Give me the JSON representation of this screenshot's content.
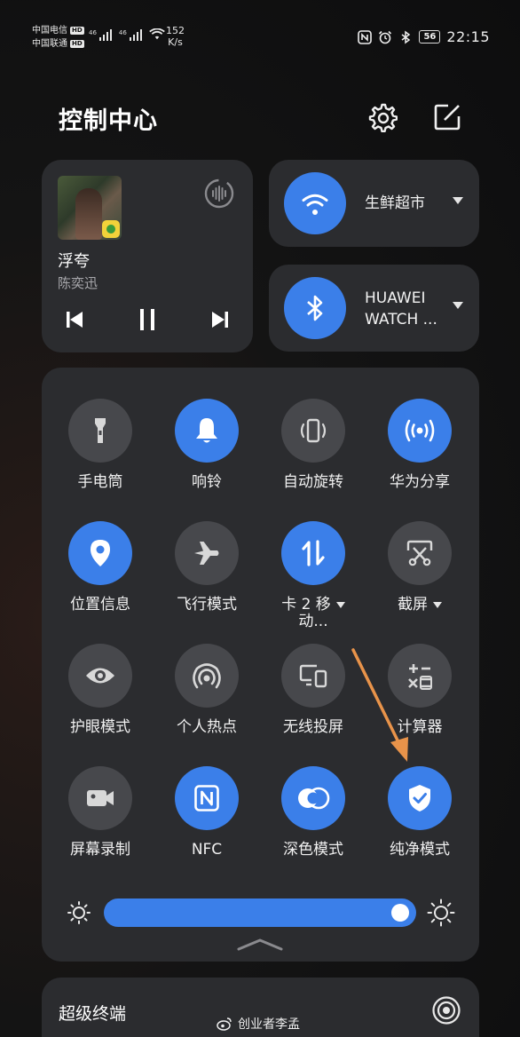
{
  "status_bar": {
    "carrier_1": "中国电信",
    "carrier_2": "中国联通",
    "hd_badge": "HD",
    "sig_1": "46",
    "sig_2": "46",
    "net_speed_value": "152",
    "net_speed_unit": "K/s",
    "battery": "56",
    "time": "22:15",
    "icons": [
      "nfc-icon",
      "alarm-icon",
      "bluetooth-icon"
    ]
  },
  "header": {
    "title": "控制中心",
    "settings_icon": "gear-icon",
    "edit_icon": "edit-icon"
  },
  "media": {
    "song": "浮夸",
    "artist": "陈奕迅",
    "controls": [
      "previous-icon",
      "pause-icon",
      "next-icon"
    ]
  },
  "wifi": {
    "label": "生鲜超市",
    "icon": "wifi-icon"
  },
  "bluetooth": {
    "label_line1": "HUAWEI",
    "label_line2": "WATCH ...",
    "icon": "bluetooth-icon"
  },
  "tiles": [
    {
      "label": "手电筒",
      "icon": "flashlight-icon",
      "on": false
    },
    {
      "label": "响铃",
      "icon": "bell-icon",
      "on": true
    },
    {
      "label": "自动旋转",
      "icon": "rotate-icon",
      "on": false
    },
    {
      "label": "华为分享",
      "icon": "share-icon",
      "on": true
    },
    {
      "label": "位置信息",
      "icon": "location-icon",
      "on": true
    },
    {
      "label": "飞行模式",
      "icon": "airplane-icon",
      "on": false
    },
    {
      "label": "卡 2 移",
      "label2": "动...",
      "icon": "data-icon",
      "on": true
    },
    {
      "label": "截屏",
      "icon": "screenshot-icon",
      "on": false
    },
    {
      "label": "护眼模式",
      "icon": "eye-icon",
      "on": false
    },
    {
      "label": "个人热点",
      "icon": "hotspot-icon",
      "on": false
    },
    {
      "label": "无线投屏",
      "icon": "cast-icon",
      "on": false
    },
    {
      "label": "计算器",
      "icon": "calculator-icon",
      "on": false
    },
    {
      "label": "屏幕录制",
      "icon": "video-icon",
      "on": false
    },
    {
      "label": "NFC",
      "icon": "nfc-icon",
      "on": true
    },
    {
      "label": "深色模式",
      "icon": "dark-mode-icon",
      "on": true
    },
    {
      "label": "纯净模式",
      "icon": "shield-icon",
      "on": true
    }
  ],
  "brightness": {
    "level_percent": 100
  },
  "super_device": {
    "label": "超级终端",
    "icon": "radar-icon"
  },
  "watermark": {
    "text": "创业者李孟"
  },
  "colors": {
    "accent": "#3b7fe9",
    "tile_off": "#47484c",
    "card": "#2b2c2f",
    "arrow": "#e8934a"
  }
}
